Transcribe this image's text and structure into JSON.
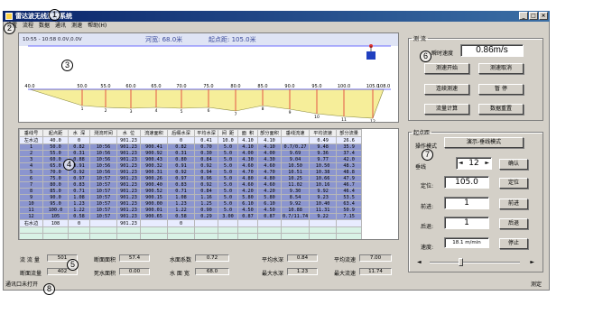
{
  "window": {
    "title": "雷达波无线测流系统"
  },
  "menu": [
    "设置",
    "流程",
    "数据",
    "通讯",
    "测速",
    "帮助(H)"
  ],
  "profile": {
    "time_range": "10:55 - 10:58  0.0V,0.0V",
    "width_text": "河宽:  68.0米",
    "start_text": "起点距:  105.0米",
    "x_labels": [
      "40.0",
      "50.0",
      "55.0",
      "60.0",
      "65.0",
      "70.0",
      "75.0",
      "80.0",
      "85.0",
      "90.0",
      "95.0",
      "100.0",
      "105.0",
      "108.0"
    ],
    "vertical_numbers": [
      "1",
      "2",
      "3",
      "4",
      "5",
      "6",
      "7",
      "8",
      "9",
      "10",
      "11",
      "12"
    ]
  },
  "table": {
    "headers": [
      "垂线号",
      "起点距",
      "水 深",
      "测流时间",
      "水 位",
      "流速面积",
      "后缀水深",
      "平均水深",
      "间 距",
      "面 积",
      "部分面积",
      "垂线流速",
      "平均流速",
      "部分流量"
    ],
    "rows": [
      [
        "左水边",
        "40.0",
        "0",
        "",
        "901.23",
        "",
        "0",
        "0.41",
        "10.0",
        "4.10",
        "4.10",
        "",
        "0.49",
        "26.6"
      ],
      [
        "1",
        "50.0",
        "0.82",
        "10:56",
        "901.23",
        "900.41",
        "0.82",
        "0.70",
        "5.0",
        "4.10",
        "4.10",
        "0.7/0.27",
        "9.48",
        "35.9"
      ],
      [
        "2",
        "55.0",
        "0.31",
        "10:56",
        "901.23",
        "900.92",
        "0.31",
        "0.30",
        "5.0",
        "4.00",
        "4.00",
        "9.69",
        "9.36",
        "37.4"
      ],
      [
        "3",
        "60.0",
        "0.88",
        "10:56",
        "901.23",
        "900.43",
        "0.80",
        "0.84",
        "5.0",
        "4.30",
        "4.30",
        "9.04",
        "9.77",
        "42.0"
      ],
      [
        "4",
        "65.0",
        "0.91",
        "10:56",
        "901.23",
        "900.32",
        "0.91",
        "0.92",
        "5.0",
        "4.60",
        "4.60",
        "10.50",
        "10.50",
        "48.3"
      ],
      [
        "5",
        "70.0",
        "0.92",
        "10:56",
        "901.23",
        "900.31",
        "0.92",
        "0.94",
        "5.0",
        "4.70",
        "4.70",
        "10.51",
        "10.38",
        "48.8"
      ],
      [
        "6",
        "75.0",
        "0.97",
        "10:57",
        "901.23",
        "900.26",
        "0.97",
        "0.96",
        "5.0",
        "4.80",
        "4.80",
        "10.25",
        "10.66",
        "47.9"
      ],
      [
        "7",
        "80.0",
        "0.83",
        "10:57",
        "901.23",
        "900.40",
        "0.83",
        "0.92",
        "5.0",
        "4.60",
        "4.60",
        "11.02",
        "10.16",
        "46.7"
      ],
      [
        "8",
        "85.0",
        "0.71",
        "10:57",
        "901.23",
        "900.52",
        "0.71",
        "0.84",
        "5.0",
        "4.20",
        "4.20",
        "9.30",
        "9.92",
        "46.4"
      ],
      [
        "9",
        "90.0",
        "1.08",
        "10:57",
        "901.23",
        "900.15",
        "1.08",
        "1.16",
        "5.0",
        "5.80",
        "5.80",
        "8.54",
        "9.23",
        "53.5"
      ],
      [
        "10",
        "95.0",
        "1.23",
        "10:57",
        "901.23",
        "900.00",
        "1.23",
        "1.25",
        "5.0",
        "6.10",
        "6.10",
        "9.92",
        "10.40",
        "63.4"
      ],
      [
        "11",
        "100.0",
        "1.22",
        "10:57",
        "901.23",
        "900.01",
        "1.22",
        "0.90",
        "5.0",
        "4.50",
        "4.50",
        "10.88",
        "11.31",
        "50.9"
      ],
      [
        "12",
        "105",
        "0.58",
        "10:57",
        "901.23",
        "900.65",
        "0.58",
        "0.29",
        "3.00",
        "0.87",
        "0.87",
        "0.7/11.74",
        "9.22",
        "7.15"
      ],
      [
        "右水边",
        "108",
        "0",
        "",
        "901.23",
        "",
        "0",
        "",
        "",
        "",
        "",
        "",
        "",
        ""
      ]
    ]
  },
  "summary": {
    "total_flow_label": "流 流 量",
    "total_flow": "501",
    "section_area_label": "断面面积",
    "section_area": "57.4",
    "water_coef_label": "水面系数",
    "water_coef": "0.72",
    "avg_depth_label": "平均水深",
    "avg_depth": "0.84",
    "avg_speed_label": "平均流速",
    "avg_speed": "7.00",
    "section_flow_label": "断面流量",
    "section_flow": "402",
    "dead_area_label": "死水面积",
    "dead_area": "0.00",
    "water_width_label": "水 面 宽",
    "water_width": "68.0",
    "max_depth_label": "最大水深",
    "max_depth": "1.23",
    "max_speed_label": "最大流速",
    "max_speed": "11.74"
  },
  "status": {
    "left": "通讯口未打开",
    "right": "测定"
  },
  "measure": {
    "title": "测 流",
    "speed_label": "瞬时速度",
    "speed_value": "0.86m/s",
    "buttons": [
      "测速开始",
      "测速取消",
      "连续测速",
      "暂 停",
      "流量计算",
      "数据重置"
    ]
  },
  "control": {
    "title": "起点距",
    "mode_label": "操作模式",
    "mode_value": "演示-垂线模式",
    "vertical_label": "垂线",
    "vertical_value": "12",
    "confirm_button": "确认",
    "position_label": "定位:",
    "position_value": "105.0",
    "position_button": "定位",
    "adjust_label": "前进:",
    "adjust_value": "1",
    "adjust_button": "前进",
    "retreat_label": "后退:",
    "retreat_value": "1",
    "retreat_button": "后退",
    "speed_label": "速度:",
    "speed_value": "18.1 m/min",
    "stop_button": "停止"
  },
  "markers": [
    "1",
    "2",
    "3",
    "4",
    "5",
    "6",
    "7",
    "8"
  ]
}
